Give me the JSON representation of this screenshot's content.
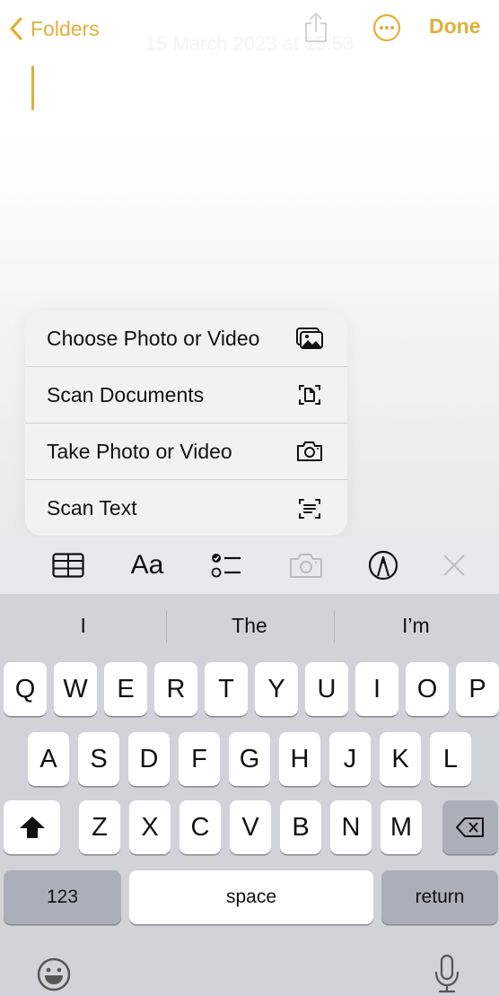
{
  "colors": {
    "accent": "#e0b03a",
    "keyboard_bg": "#d1d3d9",
    "key_bg": "#ffffff",
    "key_dark_bg": "#abafba"
  },
  "nav": {
    "back_label": "Folders",
    "back_icon": "chevron-left-icon",
    "date_stamp": "15 March 2023 at 15:53",
    "share_icon": "share-icon",
    "more_icon": "ellipsis-circle-icon",
    "done_label": "Done"
  },
  "attach_menu": {
    "items": [
      {
        "label": "Choose Photo or Video",
        "icon": "photo-library-icon"
      },
      {
        "label": "Scan Documents",
        "icon": "doc-scanner-icon"
      },
      {
        "label": "Take Photo or Video",
        "icon": "camera-icon"
      },
      {
        "label": "Scan Text",
        "icon": "text-viewfinder-icon"
      }
    ]
  },
  "toolbar": {
    "table_icon": "table-icon",
    "format_label": "Aa",
    "checklist_icon": "checklist-icon",
    "camera_icon": "camera-icon",
    "markup_icon": "markup-pen-icon",
    "close_icon": "close-icon"
  },
  "keyboard": {
    "suggestions": [
      "I",
      "The",
      "I’m"
    ],
    "row1": [
      "Q",
      "W",
      "E",
      "R",
      "T",
      "Y",
      "U",
      "I",
      "O",
      "P"
    ],
    "row2": [
      "A",
      "S",
      "D",
      "F",
      "G",
      "H",
      "J",
      "K",
      "L"
    ],
    "row3": [
      "Z",
      "X",
      "C",
      "V",
      "B",
      "N",
      "M"
    ],
    "numbers_label": "123",
    "space_label": "space",
    "return_label": "return",
    "shift_icon": "shift-icon",
    "delete_icon": "delete-backspace-icon",
    "emoji_icon": "emoji-icon",
    "mic_icon": "microphone-icon"
  }
}
